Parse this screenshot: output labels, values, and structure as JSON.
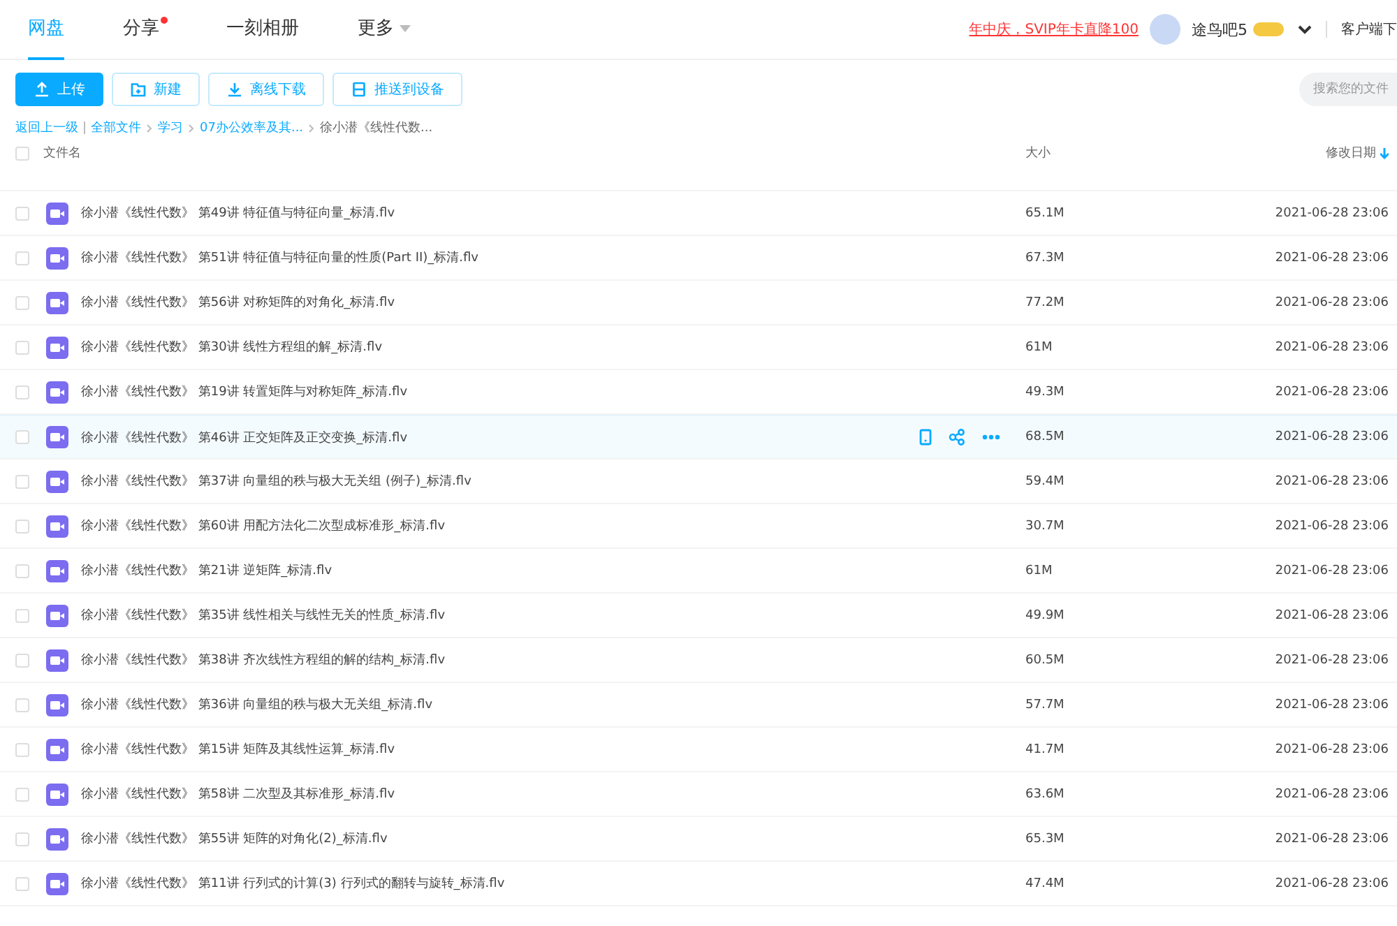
{
  "nav": {
    "tabs": [
      {
        "label": "网盘",
        "selected": true,
        "dot": false,
        "caret": false
      },
      {
        "label": "分享",
        "selected": false,
        "dot": true,
        "caret": false
      },
      {
        "label": "一刻相册",
        "selected": false,
        "dot": false,
        "caret": false
      },
      {
        "label": "更多",
        "selected": false,
        "dot": false,
        "caret": true
      }
    ],
    "promo": "年中庆，SVIP年卡直降100",
    "username": "途鸟吧5",
    "client_download": "客户端下"
  },
  "toolbar": {
    "buttons": [
      {
        "label": "上传",
        "kind": "upload"
      },
      {
        "label": "新建",
        "kind": "new"
      },
      {
        "label": "离线下载",
        "kind": "download"
      },
      {
        "label": "推送到设备",
        "kind": "device"
      }
    ],
    "search": {
      "placeholder": "搜索您的文件"
    }
  },
  "breadcrumb": {
    "back": "返回上一级",
    "items": [
      "全部文件",
      "学习",
      "07办公效率及其...",
      "徐小潜《线性代数..."
    ]
  },
  "table": {
    "all_checked": false,
    "columns": [
      "文件名",
      "大小",
      "修改日期"
    ],
    "rows": [
      {
        "name": "徐小潜《线性代数》 第49讲 特征值与特征向量_标清.flv",
        "size": "65.1M",
        "date": "2021-06-28 23:06",
        "hovered": false,
        "checked": false
      },
      {
        "name": "徐小潜《线性代数》 第51讲 特征值与特征向量的性质(Part II)_标清.flv",
        "size": "67.3M",
        "date": "2021-06-28 23:06",
        "hovered": false,
        "checked": false
      },
      {
        "name": "徐小潜《线性代数》 第56讲 对称矩阵的对角化_标清.flv",
        "size": "77.2M",
        "date": "2021-06-28 23:06",
        "hovered": false,
        "checked": false
      },
      {
        "name": "徐小潜《线性代数》 第30讲 线性方程组的解_标清.flv",
        "size": "61M",
        "date": "2021-06-28 23:06",
        "hovered": false,
        "checked": false
      },
      {
        "name": "徐小潜《线性代数》 第19讲 转置矩阵与对称矩阵_标清.flv",
        "size": "49.3M",
        "date": "2021-06-28 23:06",
        "hovered": false,
        "checked": false
      },
      {
        "name": "徐小潜《线性代数》 第46讲 正交矩阵及正交变换_标清.flv",
        "size": "68.5M",
        "date": "2021-06-28 23:06",
        "hovered": true,
        "checked": false
      },
      {
        "name": "徐小潜《线性代数》 第37讲 向量组的秩与极大无关组 (例子)_标清.flv",
        "size": "59.4M",
        "date": "2021-06-28 23:06",
        "hovered": false,
        "checked": false
      },
      {
        "name": "徐小潜《线性代数》 第60讲 用配方法化二次型成标准形_标清.flv",
        "size": "30.7M",
        "date": "2021-06-28 23:06",
        "hovered": false,
        "checked": false
      },
      {
        "name": "徐小潜《线性代数》 第21讲 逆矩阵_标清.flv",
        "size": "61M",
        "date": "2021-06-28 23:06",
        "hovered": false,
        "checked": false
      },
      {
        "name": "徐小潜《线性代数》 第35讲 线性相关与线性无关的性质_标清.flv",
        "size": "49.9M",
        "date": "2021-06-28 23:06",
        "hovered": false,
        "checked": false
      },
      {
        "name": "徐小潜《线性代数》 第38讲 齐次线性方程组的解的结构_标清.flv",
        "size": "60.5M",
        "date": "2021-06-28 23:06",
        "hovered": false,
        "checked": false
      },
      {
        "name": "徐小潜《线性代数》 第36讲 向量组的秩与极大无关组_标清.flv",
        "size": "57.7M",
        "date": "2021-06-28 23:06",
        "hovered": false,
        "checked": false
      },
      {
        "name": "徐小潜《线性代数》 第15讲 矩阵及其线性运算_标清.flv",
        "size": "41.7M",
        "date": "2021-06-28 23:06",
        "hovered": false,
        "checked": false
      },
      {
        "name": "徐小潜《线性代数》 第58讲 二次型及其标准形_标清.flv",
        "size": "63.6M",
        "date": "2021-06-28 23:06",
        "hovered": false,
        "checked": false
      },
      {
        "name": "徐小潜《线性代数》 第55讲 矩阵的对角化(2)_标清.flv",
        "size": "65.3M",
        "date": "2021-06-28 23:06",
        "hovered": false,
        "checked": false
      },
      {
        "name": "徐小潜《线性代数》 第11讲 行列式的计算(3) 行列式的翻转与旋转_标清.flv",
        "size": "47.4M",
        "date": "2021-06-28 23:06",
        "hovered": false,
        "checked": false
      }
    ]
  }
}
